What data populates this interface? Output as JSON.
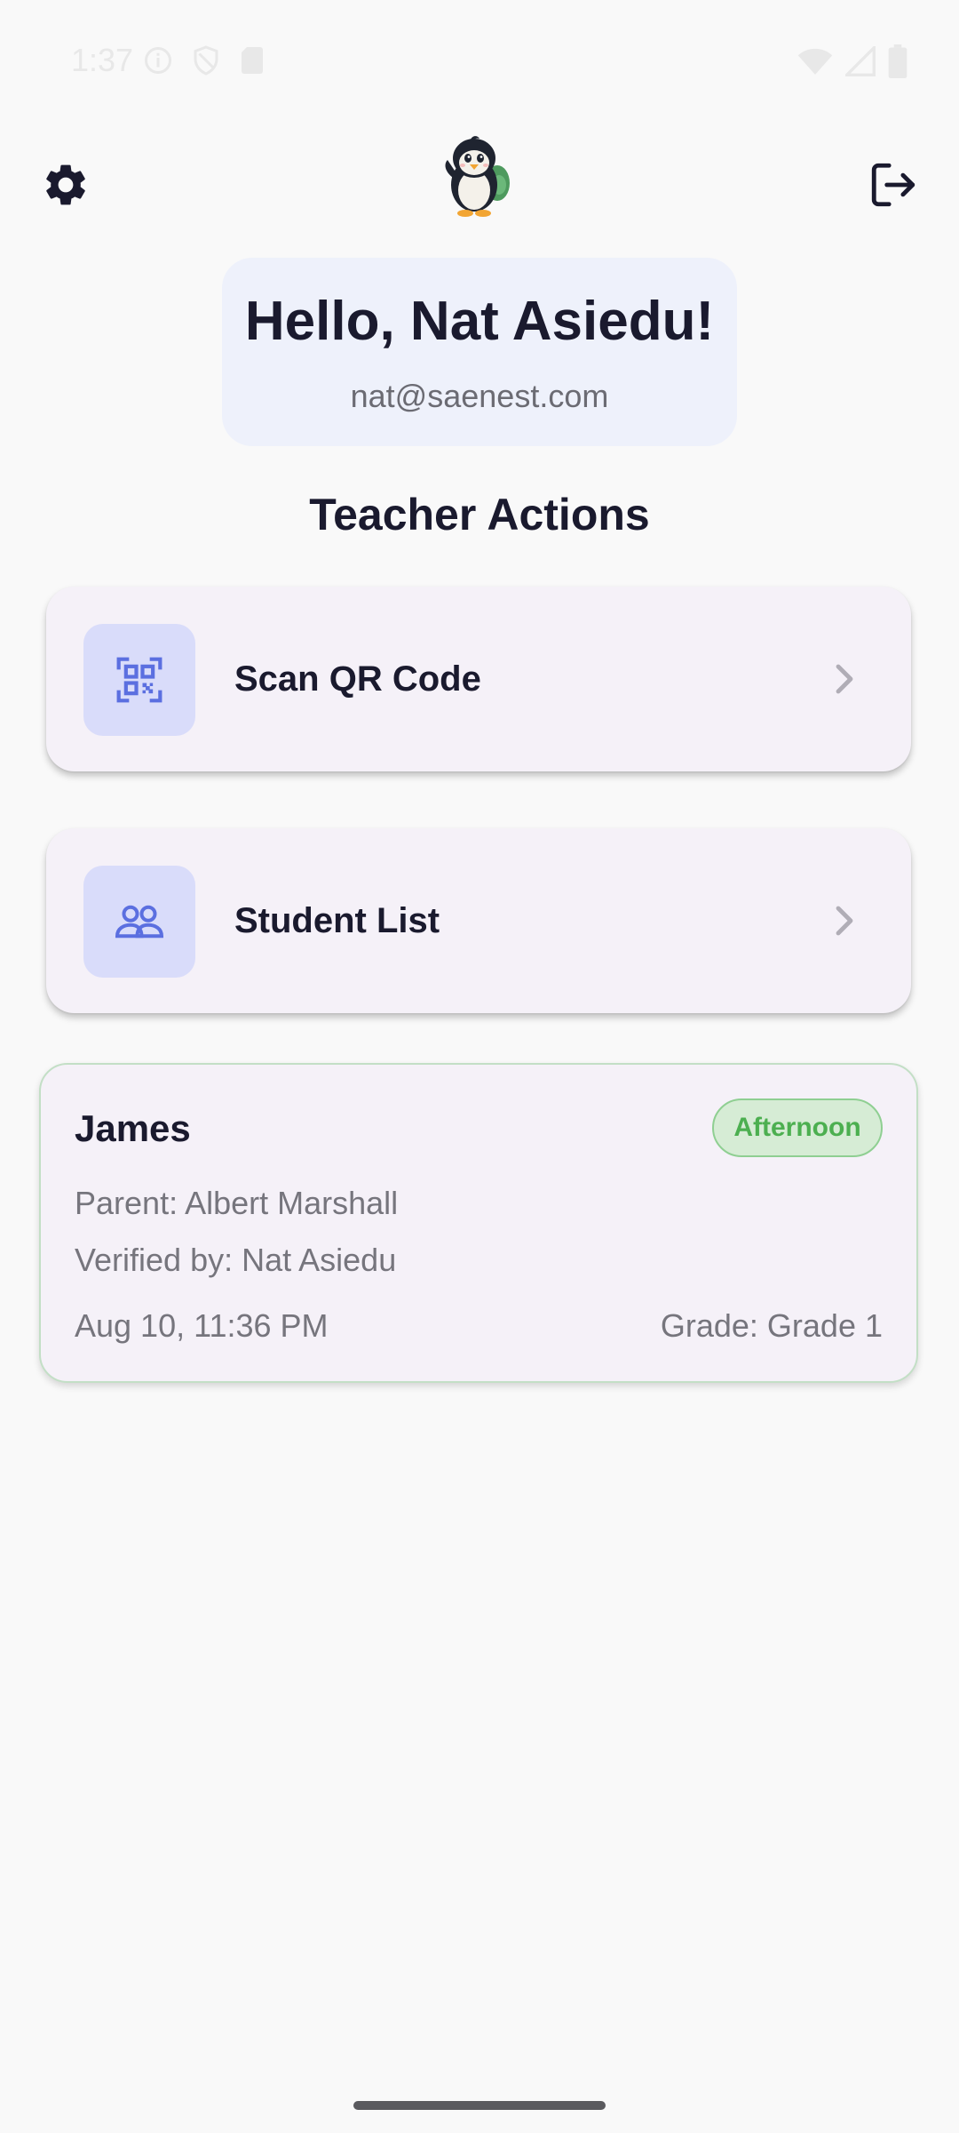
{
  "status_bar": {
    "time": "1:37",
    "icons": [
      "info-icon",
      "shield-icon",
      "sim-card-icon",
      "wifi-icon",
      "signal-icon",
      "battery-icon"
    ]
  },
  "header": {
    "left_icon": "gear-icon",
    "logo": "penguin-logo",
    "right_icon": "logout-icon"
  },
  "greeting": {
    "title": "Hello, Nat Asiedu!",
    "email": "nat@saenest.com"
  },
  "section": {
    "title": "Teacher Actions"
  },
  "actions": [
    {
      "label": "Scan QR Code",
      "icon": "qr-code-scanner-icon"
    },
    {
      "label": "Student List",
      "icon": "people-icon"
    }
  ],
  "attendance": {
    "student": "James",
    "session": "Afternoon",
    "parent": "Parent: Albert Marshall",
    "verified_by": "Verified by: Nat Asiedu",
    "timestamp": "Aug 10, 11:36 PM",
    "grade": "Grade: Grade 1"
  },
  "colors": {
    "accent": "#5b6fe0",
    "icon_bg": "#d9dcfa",
    "success": "#4caf50",
    "card_bg": "#f5f1f8"
  }
}
